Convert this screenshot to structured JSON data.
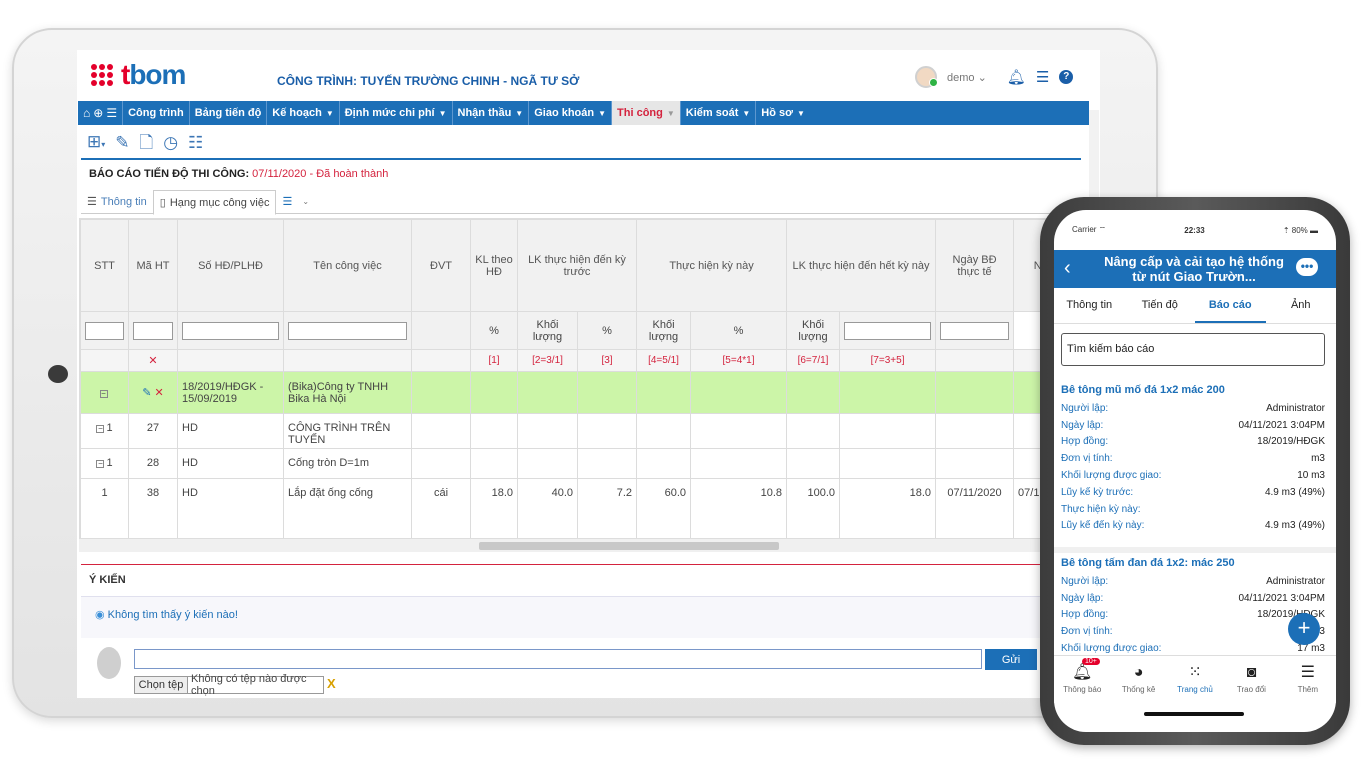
{
  "logo": {
    "text_left": "t",
    "text_right": "bom"
  },
  "project_title": "CÔNG TRÌNH: TUYẾN TRƯỜNG CHINH - NGÃ TƯ SỞ",
  "user": {
    "name": "demo ⌄"
  },
  "menu": [
    {
      "label": "Công trình",
      "caret": false
    },
    {
      "label": "Bảng tiến độ",
      "caret": false
    },
    {
      "label": "Kế hoạch",
      "caret": true
    },
    {
      "label": "Định mức chi phí",
      "caret": true
    },
    {
      "label": "Nhận thầu",
      "caret": true
    },
    {
      "label": "Giao khoán",
      "caret": true
    },
    {
      "label": "Thi công",
      "caret": true,
      "active": true
    },
    {
      "label": "Kiểm soát",
      "caret": true
    },
    {
      "label": "Hồ sơ",
      "caret": true
    }
  ],
  "report": {
    "title": "BÁO CÁO TIẾN ĐỘ THI CÔNG:",
    "date": "07/11/2020",
    "status": " - Đã hoàn thành"
  },
  "tabs": {
    "info": "Thông tin",
    "items": "Hạng mục công việc"
  },
  "grid": {
    "headers": [
      "STT",
      "Mã HT",
      "Số HĐ/PLHĐ",
      "Tên công việc",
      "ĐVT",
      "KL theo HĐ",
      "LK thực hiện đến kỳ trước",
      "Thực hiện kỳ này",
      "LK thực hiện đến hết kỳ này",
      "Ngày BĐ thực tế",
      "Ngày H"
    ],
    "subheaders": [
      "%",
      "Khối lượng",
      "%",
      "Khối lượng",
      "%",
      "Khối lượng"
    ],
    "formulas": [
      "[1]",
      "[2=3/1]",
      "[3]",
      "[4=5/1]",
      "[5=4*1]",
      "[6=7/1]",
      "[7=3+5]"
    ],
    "group": {
      "contract": "18/2019/HĐGK - 15/09/2019",
      "company": "(Bika)Công ty TNHH Bika Hà Nội"
    },
    "rows": [
      {
        "stt": "1",
        "ma": "27",
        "hd": "HD",
        "ten": "CÔNG TRÌNH TRÊN TUYẾN",
        "dvt": "",
        "kl": "",
        "p1": "",
        "k1": "",
        "p2": "",
        "k2": "",
        "p3": "",
        "k3": "",
        "ngay": "",
        "ngay2": ""
      },
      {
        "stt": "1",
        "ma": "28",
        "hd": "HD",
        "ten": "Cống tròn D=1m",
        "dvt": "",
        "kl": "",
        "p1": "",
        "k1": "",
        "p2": "",
        "k2": "",
        "p3": "",
        "k3": "",
        "ngay": "",
        "ngay2": ""
      },
      {
        "stt": "1",
        "ma": "38",
        "hd": "HD",
        "ten": "Lắp đặt ống cống",
        "dvt": "cái",
        "kl": "18.0",
        "p1": "40.0",
        "k1": "7.2",
        "p2": "60.0",
        "k2": "10.8",
        "p3": "100.0",
        "k3": "18.0",
        "ngay": "07/11/2020",
        "ngay2": "07/1"
      }
    ]
  },
  "comments": {
    "title": "Ý KIẾN",
    "empty": "Không tìm thấy ý kiến nào!",
    "send": "Gửi",
    "choose_file": "Chọn tệp",
    "no_file": "Không có tệp nào được chọn"
  },
  "phone": {
    "status": {
      "carrier": "Carrier ⌔",
      "time": "22:33",
      "battery": "⇡ 80% ▬"
    },
    "title": "Nâng cấp và cải tạo hệ thống từ nút Giao Trườn...",
    "tabs": [
      "Thông tin",
      "Tiến độ",
      "Báo cáo",
      "Ảnh"
    ],
    "search_placeholder": "Tìm kiếm báo cáo",
    "reports": [
      {
        "title": "Bê tông mũ mố đá 1x2  mác 200",
        "fields": [
          {
            "k": "Người lập:",
            "v": "Administrator"
          },
          {
            "k": "Ngày lập:",
            "v": "04/11/2021  3:04PM"
          },
          {
            "k": "Hợp đồng:",
            "v": "18/2019/HĐGK"
          },
          {
            "k": "Đơn vị tính:",
            "v": "m3"
          },
          {
            "k": "Khối lượng được giao:",
            "v": "10 m3"
          },
          {
            "k": "Lũy kế kỳ trước:",
            "v": "4.9 m3 (49%)"
          },
          {
            "k": "Thực hiện kỳ này:",
            "v": ""
          },
          {
            "k": "Lũy kế đến kỳ này:",
            "v": "4.9 m3 (49%)"
          }
        ]
      },
      {
        "title": "Bê tông tấm đan đá 1x2:  mác 250",
        "fields": [
          {
            "k": "Người lập:",
            "v": "Administrator"
          },
          {
            "k": "Ngày lập:",
            "v": "04/11/2021  3:04PM"
          },
          {
            "k": "Hợp đồng:",
            "v": "18/2019/HĐGK"
          },
          {
            "k": "Đơn vị tính:",
            "v": "m3"
          },
          {
            "k": "Khối lượng được giao:",
            "v": "17 m3"
          }
        ]
      }
    ],
    "nav": [
      {
        "label": "Thông báo",
        "icon": "bell-icon",
        "badge": "10+"
      },
      {
        "label": "Thống kê",
        "icon": "pie-chart-icon"
      },
      {
        "label": "Trang chủ",
        "icon": "grid-dots-icon",
        "active": true
      },
      {
        "label": "Trao đổi",
        "icon": "chat-icon"
      },
      {
        "label": "Thêm",
        "icon": "menu-icon"
      }
    ]
  },
  "colors": {
    "brand_blue": "#1c6fb7",
    "brand_red": "#e4002b",
    "group_green": "#ccf5a8"
  }
}
